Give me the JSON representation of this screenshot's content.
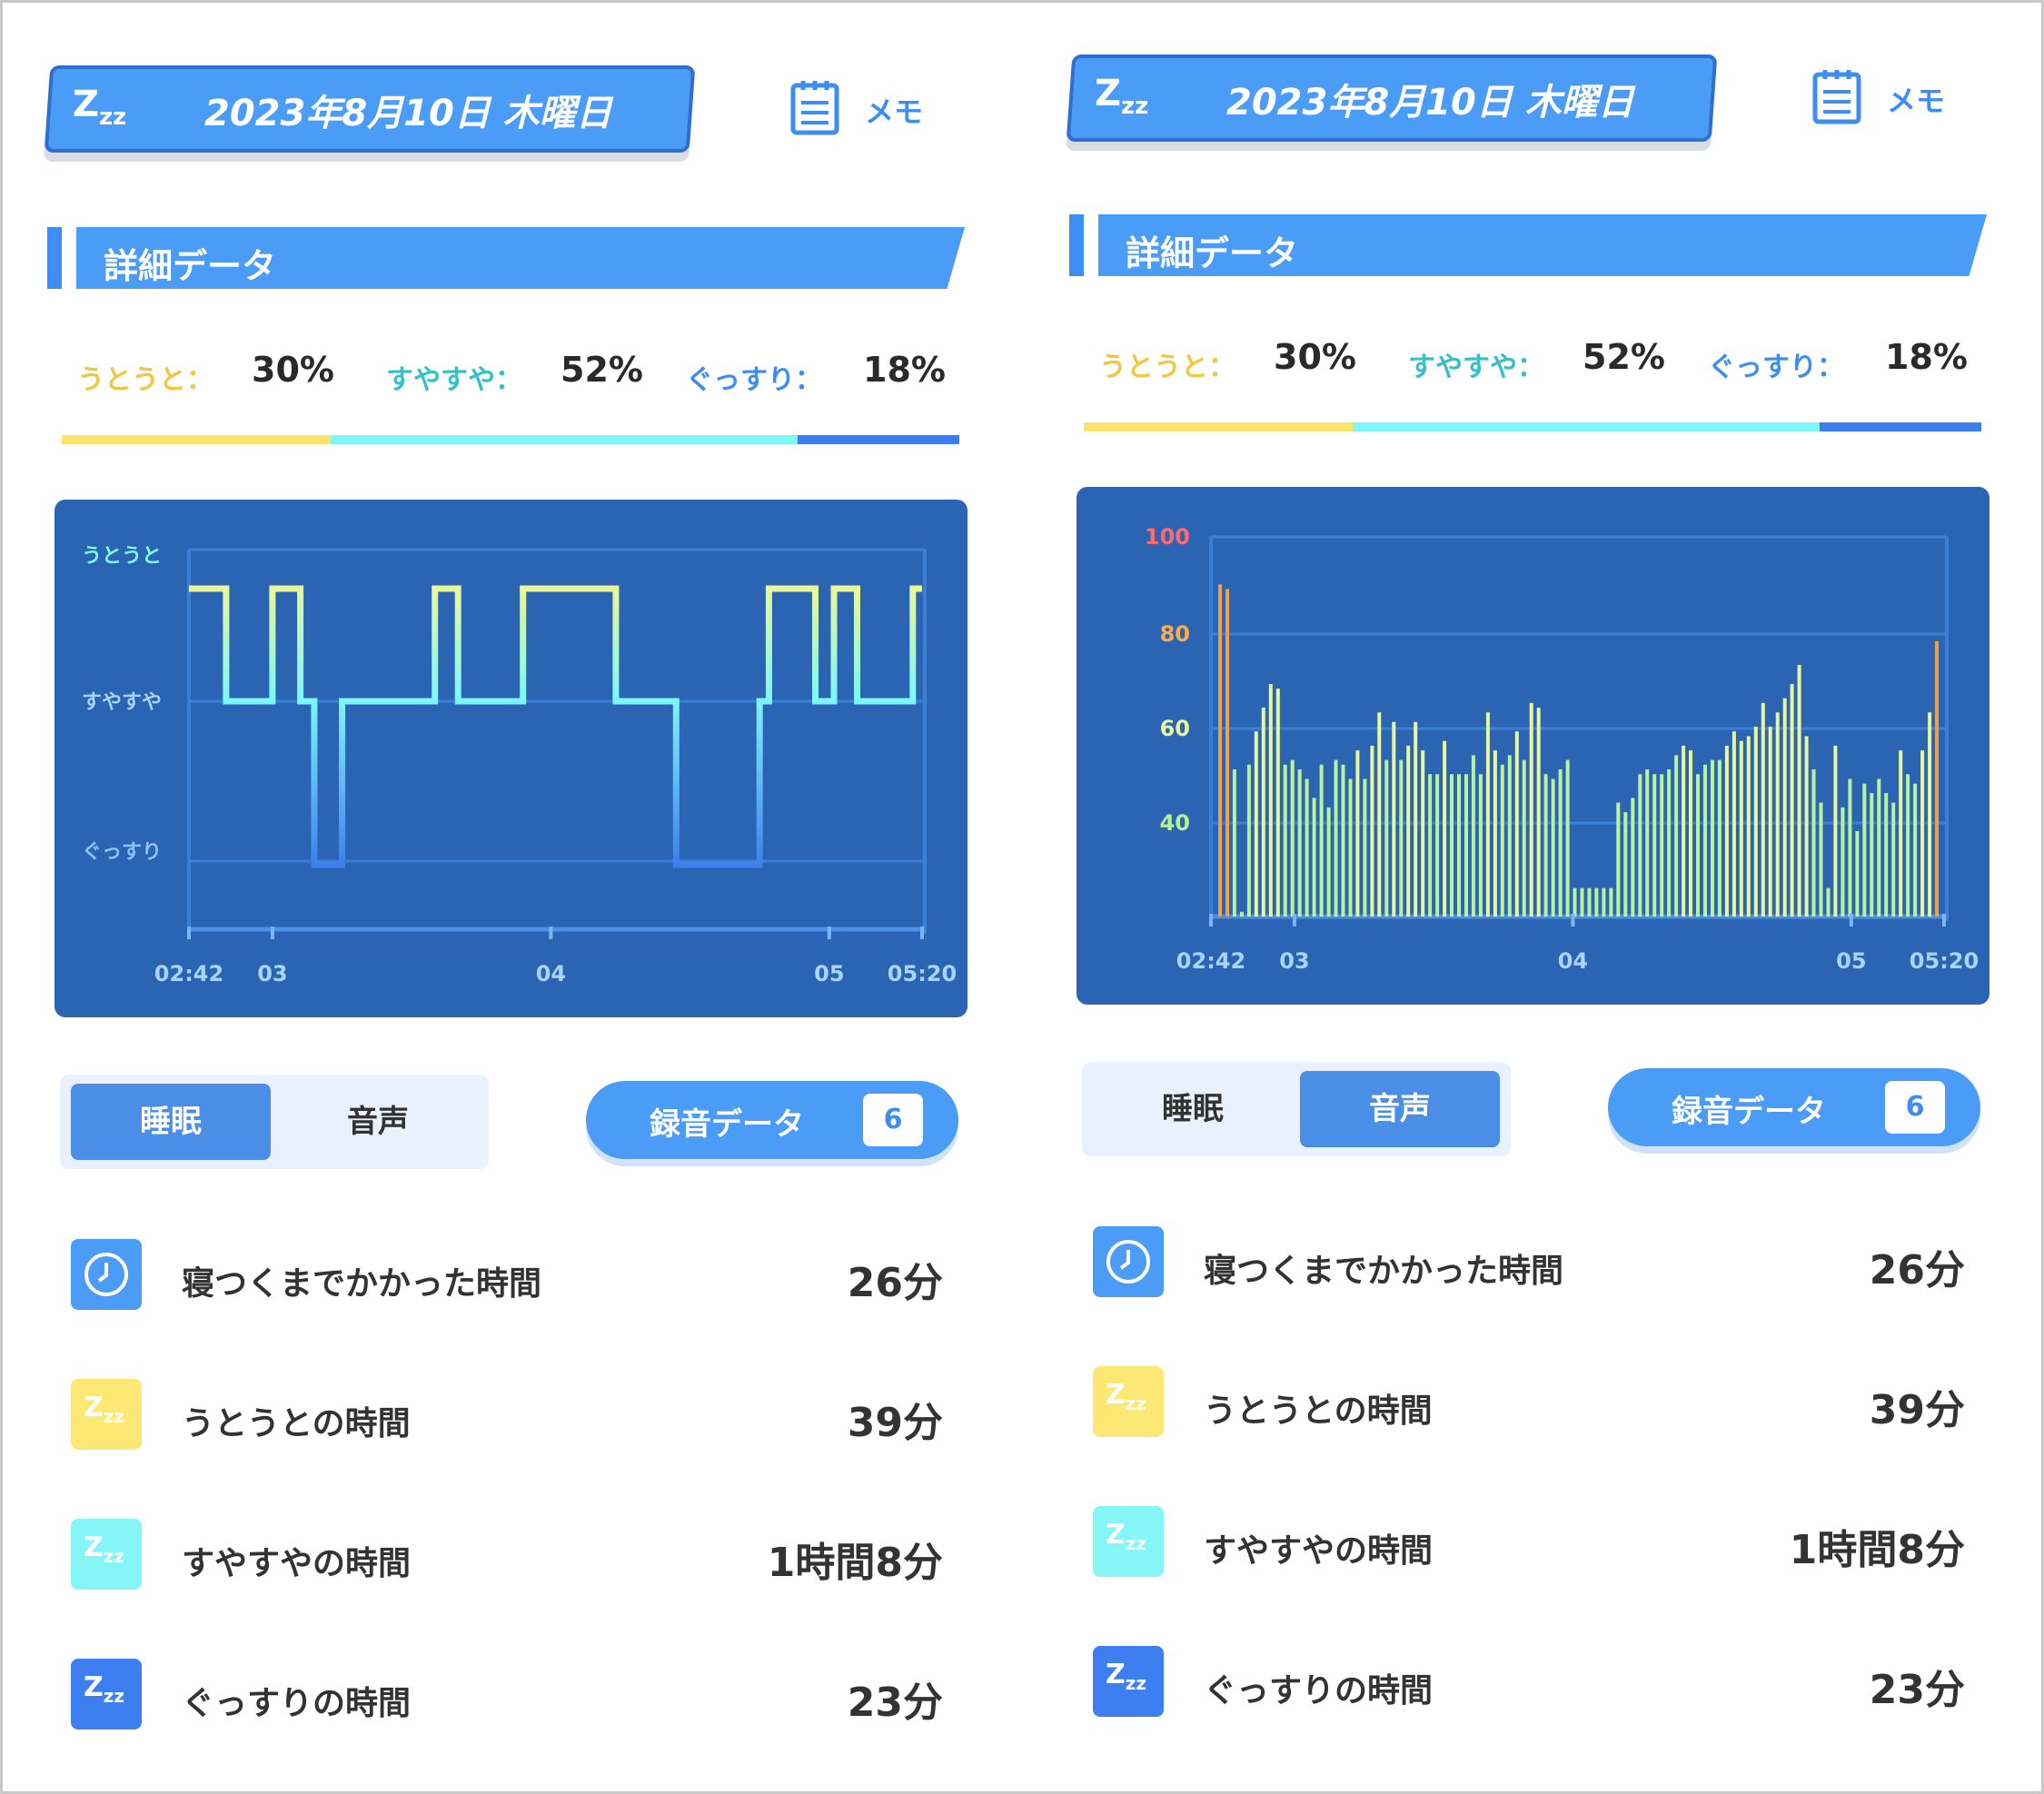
{
  "colors": {
    "primary": "#4a9cf6",
    "utouto": "#fbe46e",
    "suyasuya": "#7ef7f6",
    "gussuri": "#3d7ff0",
    "chart_bg": "#2a64b3"
  },
  "panels": [
    {
      "header": {
        "icon": "zzz-icon",
        "date": "2023年8月10日 木曜日",
        "memo_icon": "notepad-icon",
        "memo_label": "メモ"
      },
      "section_title": "詳細データ",
      "stats": [
        {
          "label": "うとうと：",
          "value": "30%",
          "percent": 30,
          "color": "#f2c744"
        },
        {
          "label": "すやすや：",
          "value": "52%",
          "percent": 52,
          "color": "#38c0c8"
        },
        {
          "label": "ぐっすり：",
          "value": "18%",
          "percent": 18,
          "color": "#3d8df2"
        }
      ],
      "tabs": {
        "left": "睡眠",
        "right": "音声",
        "active": "left"
      },
      "record": {
        "label": "録音データ",
        "count": "6"
      },
      "rows": [
        {
          "icon": "clock-icon",
          "label": "寝つくまでかかった時間",
          "value": "26分"
        },
        {
          "icon": "zzz-yellow-icon",
          "label": "うとうとの時間",
          "value": "39分"
        },
        {
          "icon": "zzz-cyan-icon",
          "label": "すやすやの時間",
          "value": "1時間8分"
        },
        {
          "icon": "zzz-blue-icon",
          "label": "ぐっすりの時間",
          "value": "23分"
        }
      ]
    },
    {
      "header": {
        "icon": "zzz-icon",
        "date": "2023年8月10日 木曜日",
        "memo_icon": "notepad-icon",
        "memo_label": "メモ"
      },
      "section_title": "詳細データ",
      "stats": [
        {
          "label": "うとうと：",
          "value": "30%",
          "percent": 30,
          "color": "#f2c744"
        },
        {
          "label": "すやすや：",
          "value": "52%",
          "percent": 52,
          "color": "#38c0c8"
        },
        {
          "label": "ぐっすり：",
          "value": "18%",
          "percent": 18,
          "color": "#3d8df2"
        }
      ],
      "tabs": {
        "left": "睡眠",
        "right": "音声",
        "active": "right"
      },
      "record": {
        "label": "録音データ",
        "count": "6"
      },
      "rows": [
        {
          "icon": "clock-icon",
          "label": "寝つくまでかかった時間",
          "value": "26分"
        },
        {
          "icon": "zzz-yellow-icon",
          "label": "うとうとの時間",
          "value": "39分"
        },
        {
          "icon": "zzz-cyan-icon",
          "label": "すやすやの時間",
          "value": "1時間8分"
        },
        {
          "icon": "zzz-blue-icon",
          "label": "ぐっすりの時間",
          "value": "23分"
        }
      ]
    }
  ],
  "chart_data": [
    {
      "type": "line",
      "step": true,
      "y_categories": [
        "ぐっすり",
        "すやすや",
        "うとうと"
      ],
      "x_ticks": [
        "02:42",
        "03",
        "04",
        "05",
        "05:20"
      ],
      "x_range": [
        "02:42",
        "05:20"
      ],
      "segments": [
        {
          "start": "02:42",
          "end": "02:50",
          "level": "うとうと"
        },
        {
          "start": "02:50",
          "end": "03:00",
          "level": "すやすや"
        },
        {
          "start": "03:00",
          "end": "03:06",
          "level": "うとうと"
        },
        {
          "start": "03:06",
          "end": "03:09",
          "level": "すやすや"
        },
        {
          "start": "03:09",
          "end": "03:15",
          "level": "ぐっすり"
        },
        {
          "start": "03:15",
          "end": "03:35",
          "level": "すやすや"
        },
        {
          "start": "03:35",
          "end": "03:40",
          "level": "うとうと"
        },
        {
          "start": "03:40",
          "end": "03:54",
          "level": "すやすや"
        },
        {
          "start": "03:54",
          "end": "04:14",
          "level": "うとうと"
        },
        {
          "start": "04:14",
          "end": "04:27",
          "level": "すやすや"
        },
        {
          "start": "04:27",
          "end": "04:45",
          "level": "ぐっすり"
        },
        {
          "start": "04:45",
          "end": "04:47",
          "level": "すやすや"
        },
        {
          "start": "04:47",
          "end": "04:57",
          "level": "うとうと"
        },
        {
          "start": "04:57",
          "end": "05:01",
          "level": "すやすや"
        },
        {
          "start": "05:01",
          "end": "05:06",
          "level": "うとうと"
        },
        {
          "start": "05:06",
          "end": "05:18",
          "level": "すやすや"
        },
        {
          "start": "05:18",
          "end": "05:20",
          "level": "うとうと"
        }
      ]
    },
    {
      "type": "bar",
      "y_ticks": [
        40,
        60,
        80,
        100
      ],
      "ylim": [
        20,
        100
      ],
      "x_ticks": [
        "02:42",
        "03",
        "04",
        "05",
        "05:20"
      ],
      "x_range": [
        "02:42",
        "05:20"
      ],
      "values": [
        90,
        89,
        51,
        21,
        52,
        59,
        64,
        69,
        68,
        52,
        53,
        51,
        49,
        45,
        52,
        43,
        53,
        52,
        49,
        55,
        49,
        56,
        63,
        53,
        61,
        53,
        56,
        61,
        55,
        50,
        50,
        57,
        50,
        50,
        50,
        54,
        50,
        63,
        55,
        52,
        54,
        59,
        53,
        65,
        64,
        50,
        49,
        51,
        53,
        26,
        26,
        26,
        26,
        26,
        26,
        44,
        42,
        45,
        50,
        51,
        50,
        50,
        51,
        54,
        56,
        55,
        50,
        52,
        53,
        53,
        56,
        59,
        57,
        58,
        60,
        65,
        60,
        63,
        66,
        69,
        73,
        58,
        51,
        44,
        26,
        56,
        43,
        49,
        38,
        48,
        46,
        49,
        46,
        44,
        55,
        50,
        48,
        55,
        63,
        78
      ]
    }
  ]
}
